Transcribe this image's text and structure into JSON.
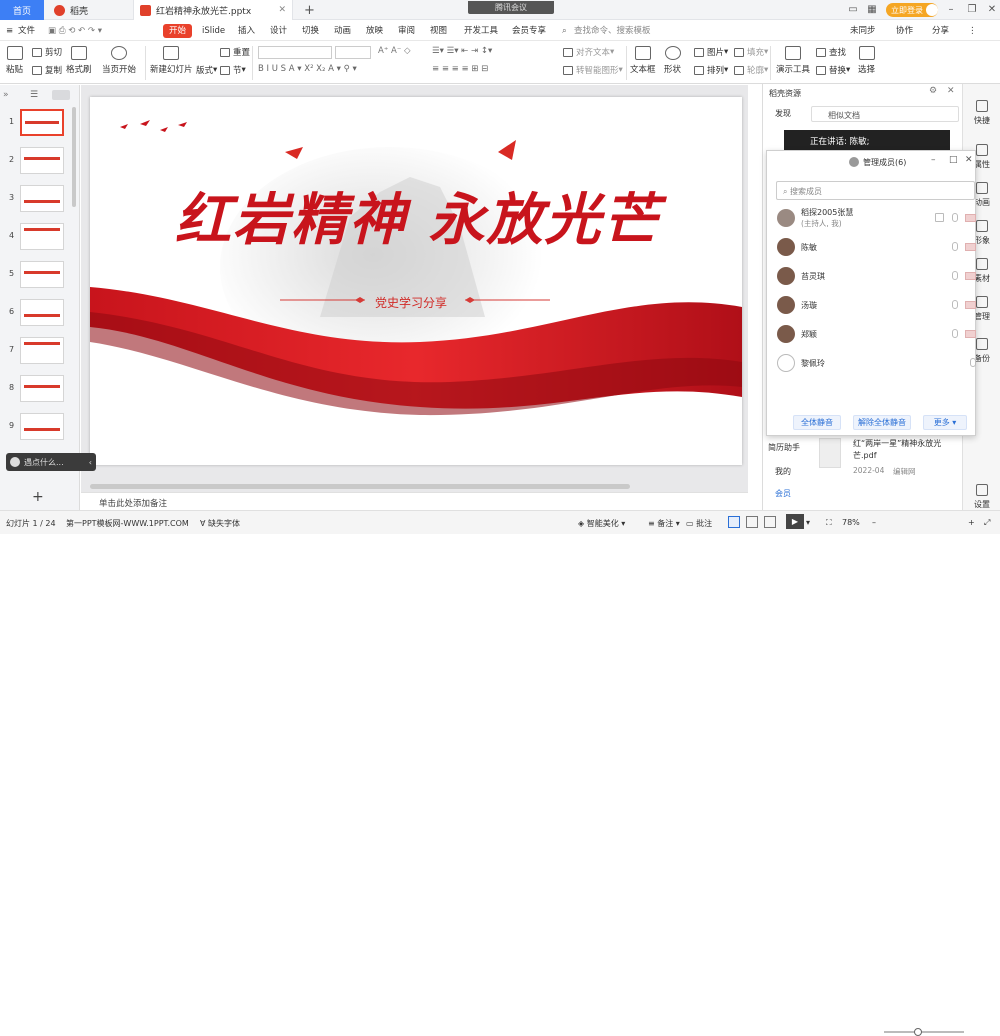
{
  "titlebar": {
    "home_tab": "首页",
    "doc_tab": "稻壳",
    "file_tab": "红岩精神永放光芒.pptx",
    "new_tab": "+",
    "meeting": "腾讯会议",
    "login": "立即登录"
  },
  "ribbon_tabs": [
    "文件",
    "开始",
    "iSlide",
    "插入",
    "设计",
    "切换",
    "动画",
    "放映",
    "审阅",
    "视图",
    "开发工具",
    "会员专享"
  ],
  "search_placeholder": "查找命令、搜索模板",
  "sync": "未同步",
  "collab": "协作",
  "share": "分享",
  "toolbar": {
    "paste": "粘贴",
    "cut": "剪切",
    "copy": "复制",
    "format_painter": "格式刷",
    "play_current": "当页开始",
    "new_slide": "新建幻灯片",
    "layout": "版式",
    "section": "节",
    "reset": "重置",
    "align_text": "对齐文本",
    "convert_smartart": "转智能图形",
    "textbox": "文本框",
    "shape": "形状",
    "arrange": "排列",
    "picture": "图片",
    "fill": "填充",
    "outline": "轮廓",
    "presenter": "演示工具",
    "find": "查找",
    "replace": "替换",
    "select": "选择"
  },
  "slide": {
    "title": "红岩精神 永放光芒",
    "subtitle": "党史学习分享"
  },
  "slide_count": 9,
  "notes_placeholder": "单击此处添加备注",
  "statusbar": {
    "slide_info": "幻灯片 1 / 24",
    "template": "第一PPT模板网-WWW.1PPT.COM",
    "missing_font": "缺失字体",
    "beautify": "智能美化",
    "notes": "备注",
    "comments": "批注",
    "zoom": "78%"
  },
  "right_panel": {
    "title": "稻壳资源",
    "discover": "发现",
    "search_hint": "相似文档",
    "speaking": "正在讲话: 陈敏;",
    "doc_title": "红“两岸一星”精神永放光芒.pdf",
    "doc_date": "2022-04",
    "doc_edit": "编辑网",
    "assistant": "简历助手",
    "mine": "我的",
    "vip": "会员"
  },
  "members_panel": {
    "title": "管理成员(6)",
    "search_placeholder": "搜索成员",
    "members": [
      {
        "name": "稻探2005张慧",
        "sub": "(主持人, 我)"
      },
      {
        "name": "陈敏",
        "sub": ""
      },
      {
        "name": "苔灵琪",
        "sub": ""
      },
      {
        "name": "汤璇",
        "sub": ""
      },
      {
        "name": "郑颖",
        "sub": ""
      },
      {
        "name": "黎佩玲",
        "sub": ""
      }
    ],
    "mute_all": "全体静音",
    "unmute_all": "解除全体静音",
    "more": "更多"
  },
  "rail": [
    "快捷",
    "属性",
    "动画",
    "形象",
    "素材",
    "管理",
    "备份",
    "设置"
  ],
  "ask_bubble": "遇点什么..."
}
